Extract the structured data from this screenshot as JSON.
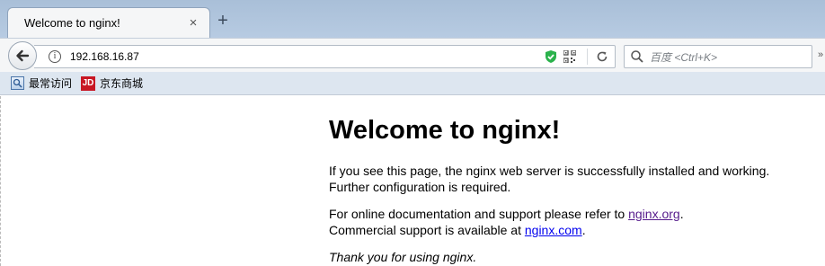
{
  "tab": {
    "title": "Welcome to nginx!",
    "close": "×",
    "new_tab": "+"
  },
  "nav": {
    "url": "192.168.16.87",
    "info_icon": "i",
    "search_placeholder": "百度 <Ctrl+K>",
    "overflow": "»"
  },
  "bookmarks": [
    {
      "label": "最常访问",
      "icon": "frequent-icon"
    },
    {
      "label": "京东商城",
      "icon": "jd-icon",
      "icon_text": "JD"
    }
  ],
  "page": {
    "heading": "Welcome to nginx!",
    "para1_line1": "If you see this page, the nginx web server is successfully installed and working.",
    "para1_line2": "Further configuration is required.",
    "para2_line1_prefix": "For online documentation and support please refer to ",
    "para2_link1": "nginx.org",
    "para2_line1_suffix": ".",
    "para2_line2_prefix": "Commercial support is available at ",
    "para2_link2": "nginx.com",
    "para2_line2_suffix": ".",
    "thanks": "Thank you for using nginx."
  },
  "colors": {
    "link_visited": "#551a8b",
    "link": "#0000ee",
    "jd_brand": "#c81623"
  }
}
